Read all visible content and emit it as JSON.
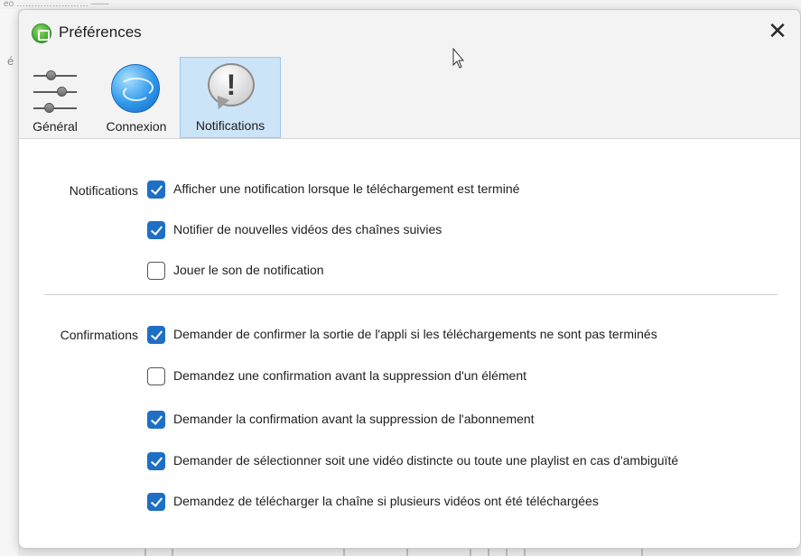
{
  "background": {
    "top_text": "eo …………………… ——",
    "side_letter": "é"
  },
  "dialog": {
    "title": "Préférences",
    "close_symbol": "✕"
  },
  "tabs": [
    {
      "id": "general",
      "label": "Général",
      "icon": "sliders-icon",
      "selected": false
    },
    {
      "id": "connexion",
      "label": "Connexion",
      "icon": "globe-icon",
      "selected": false
    },
    {
      "id": "notifications",
      "label": "Notifications",
      "icon": "alert-bubble-icon",
      "selected": true
    }
  ],
  "notifications_section": {
    "label": "Notifications",
    "options": [
      {
        "label": "Afficher une notification lorsque le téléchargement est terminé",
        "checked": true
      },
      {
        "label": "Notifier de nouvelles vidéos des chaînes suivies",
        "checked": true
      },
      {
        "label": "Jouer le son de notification",
        "checked": false
      }
    ]
  },
  "confirmations_section": {
    "label": "Confirmations",
    "options": [
      {
        "label": "Demander de confirmer la sortie de l'appli si les téléchargements ne sont pas terminés",
        "checked": true
      },
      {
        "label": "Demandez une confirmation avant la suppression d'un élément",
        "checked": false
      },
      {
        "label": "Demander la confirmation avant la suppression de l'abonnement",
        "checked": true
      },
      {
        "label": "Demander de sélectionner soit une vidéo distincte ou toute une playlist en cas d'ambiguïté",
        "checked": true
      },
      {
        "label": "Demandez de télécharger la chaîne si plusieurs vidéos ont été téléchargées",
        "checked": true
      }
    ]
  },
  "colors": {
    "accent": "#1f6fc5",
    "selected_tab_bg": "#cce4f7",
    "header_bg": "#f3f3f3"
  }
}
